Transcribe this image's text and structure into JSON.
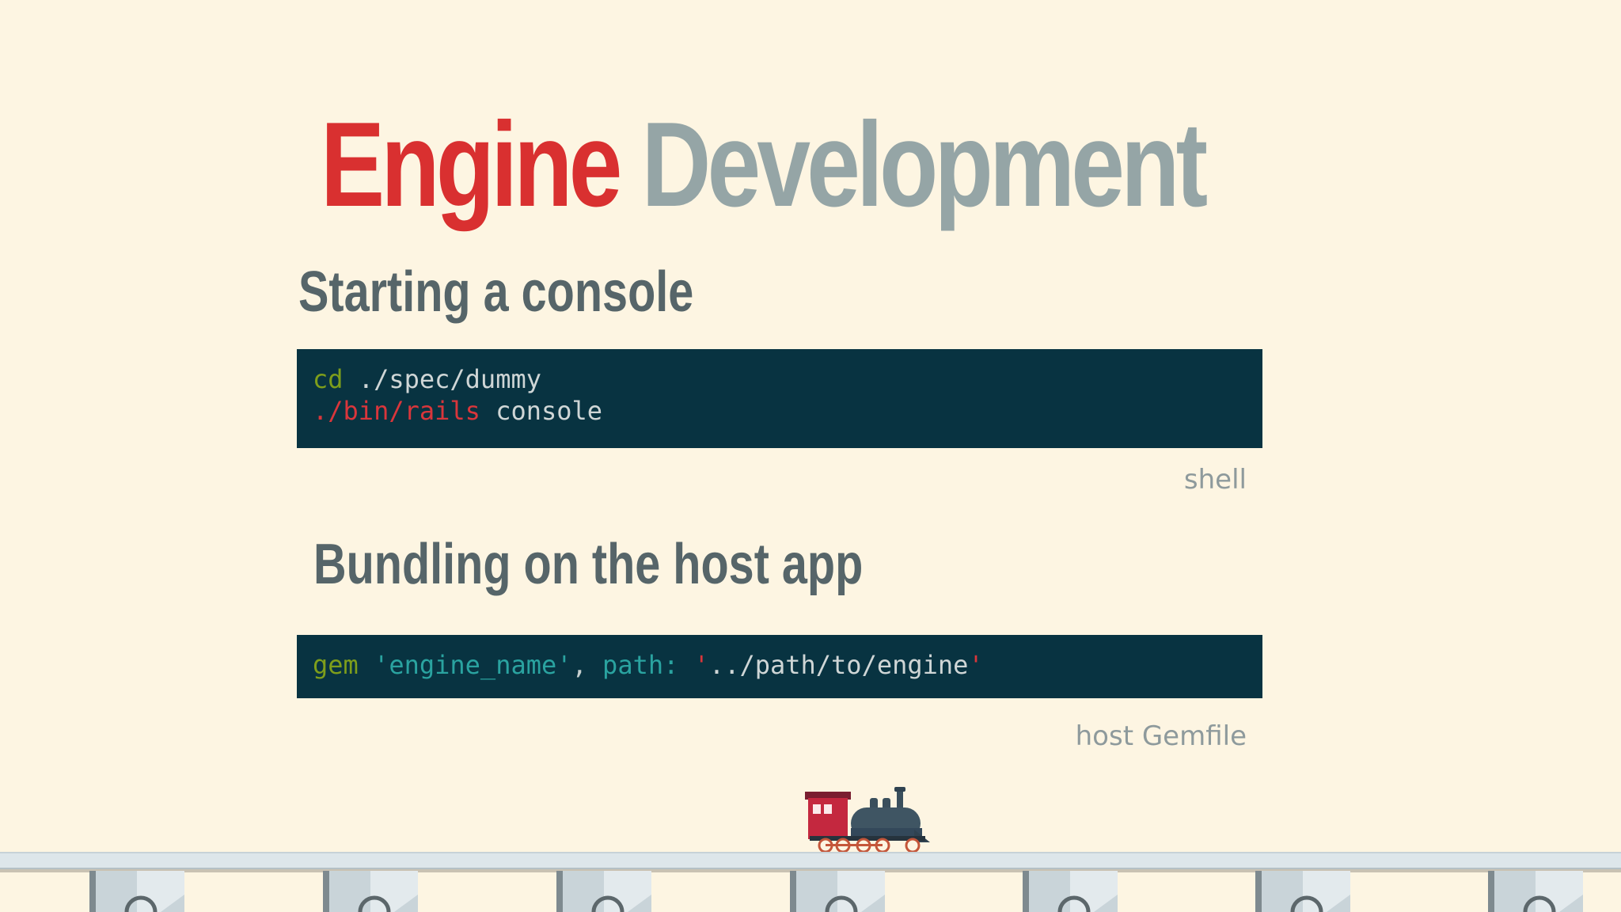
{
  "title": {
    "word1": "Engine",
    "word2": "Development"
  },
  "section1": {
    "heading": "Starting a console",
    "code": {
      "line1": {
        "cmd": "cd",
        "arg": " ./spec/dummy"
      },
      "line2": {
        "cmd": "./bin/rails",
        "arg": " console"
      }
    },
    "caption": "shell"
  },
  "section2": {
    "heading": "Bundling on the host app",
    "code": {
      "kw": "gem",
      "str1": "'engine_name'",
      "comma": ",",
      "sym": "path:",
      "q_open": "'",
      "path": "../path/to/engine",
      "q_close": "'"
    },
    "caption": "host Gemfile"
  },
  "icons": {
    "train": "locomotive-icon"
  },
  "colors": {
    "background": "#fdf5e2",
    "title_accent": "#d93030",
    "title_muted": "#95a5a6",
    "heading": "#566569",
    "code_bg": "#083341"
  }
}
